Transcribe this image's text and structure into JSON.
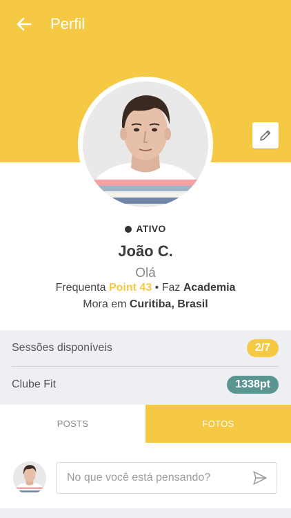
{
  "header": {
    "title": "Perfil",
    "back_icon": "arrow-left-icon",
    "edit_icon": "pencil-icon",
    "background": "#F6C944"
  },
  "profile": {
    "status": "ATIVO",
    "name": "João C.",
    "greeting": "Olá",
    "frequents_prefix": "Frequenta",
    "gym": "Point 43",
    "separator": "•",
    "does_prefix": "Faz",
    "activity": "Academia",
    "lives_prefix": "Mora em",
    "location": "Curitiba, Brasil"
  },
  "stats": [
    {
      "label": "Sessões disponíveis",
      "value": "2/7",
      "color": "#F6C944"
    },
    {
      "label": "Clube Fit",
      "value": "1338pt",
      "color": "#5B9592"
    }
  ],
  "tabs": [
    {
      "label": "POSTS",
      "active": false
    },
    {
      "label": "FOTOS",
      "active": true
    }
  ],
  "composer": {
    "placeholder": "No que você está pensando?",
    "send_icon": "send-icon"
  }
}
